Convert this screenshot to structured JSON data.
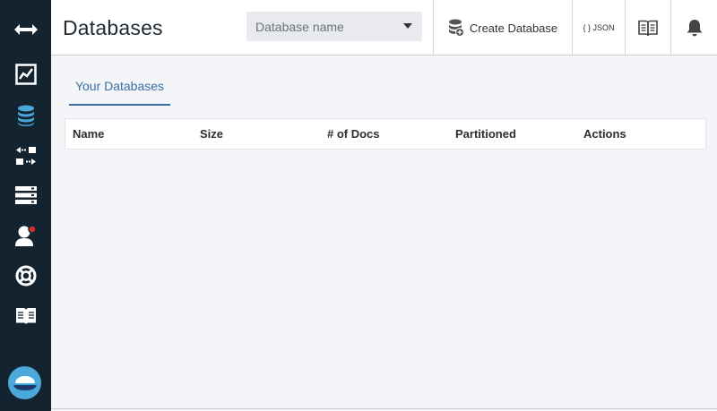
{
  "header": {
    "title": "Databases",
    "search_placeholder": "Database name",
    "create_label": "Create Database",
    "json_label": "{ } JSON"
  },
  "tabs": [
    {
      "label": "Your Databases",
      "active": true
    }
  ],
  "table": {
    "columns": [
      "Name",
      "Size",
      "# of Docs",
      "Partitioned",
      "Actions"
    ],
    "rows": []
  },
  "sidebar": {
    "items": [
      {
        "icon": "expand-arrows-icon"
      },
      {
        "icon": "monitoring-chart-icon"
      },
      {
        "icon": "databases-icon",
        "active": true
      },
      {
        "icon": "replication-icon"
      },
      {
        "icon": "active-tasks-icon"
      },
      {
        "icon": "user-notification-icon"
      },
      {
        "icon": "support-lifebuoy-icon"
      },
      {
        "icon": "documentation-book-icon"
      }
    ],
    "logo_icon": "cloudant-logo-icon"
  },
  "colors": {
    "sidebar_bg": "#13232f",
    "accent": "#3a6ea5",
    "active_icon": "#4aa9da",
    "notification_dot": "#e02b2b"
  }
}
